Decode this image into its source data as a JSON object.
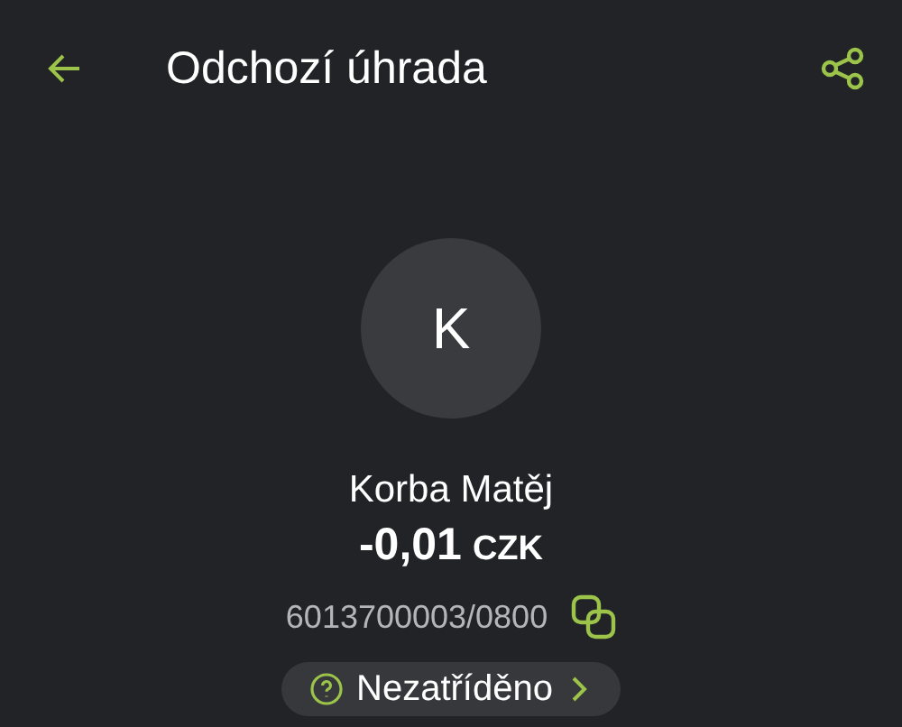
{
  "header": {
    "title": "Odchozí úhrada"
  },
  "counterparty": {
    "initial": "K",
    "name": "Korba Matěj",
    "amount": "-0,01",
    "currency": "CZK",
    "account": "6013700003/0800"
  },
  "category": {
    "label": "Nezatříděno"
  }
}
